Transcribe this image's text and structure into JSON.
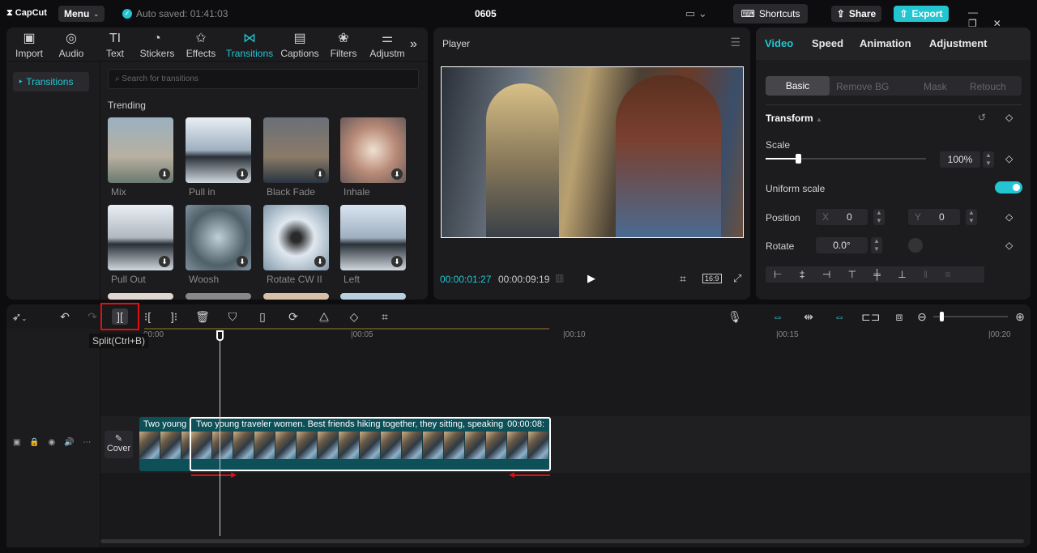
{
  "app": {
    "logo": "CapCut",
    "menu": "Menu",
    "autosave": "Auto saved: 01:41:03",
    "project": "0605",
    "shortcuts": "Shortcuts",
    "share": "Share",
    "export": "Export",
    "accent": "#22c5d0"
  },
  "toolbar": [
    {
      "label": "Import",
      "icon": "import-icon"
    },
    {
      "label": "Audio",
      "icon": "audio-icon"
    },
    {
      "label": "Text",
      "icon": "text-icon"
    },
    {
      "label": "Stickers",
      "icon": "stickers-icon"
    },
    {
      "label": "Effects",
      "icon": "effects-icon"
    },
    {
      "label": "Transitions",
      "icon": "transitions-icon"
    },
    {
      "label": "Captions",
      "icon": "captions-icon"
    },
    {
      "label": "Filters",
      "icon": "filters-icon"
    },
    {
      "label": "Adjustm",
      "icon": "adjustment-icon"
    }
  ],
  "sidebar": {
    "item": "Transitions"
  },
  "search": {
    "placeholder": "Search for transitions"
  },
  "section": "Trending",
  "transitions": [
    "Mix",
    "Pull in",
    "Black Fade",
    "Inhale",
    "Pull Out",
    "Woosh",
    "Rotate CW II",
    "Left"
  ],
  "player": {
    "title": "Player",
    "current": "00:00:01:27",
    "total": "00:00:09:19",
    "ratio": "16:9"
  },
  "inspector": {
    "tabs": [
      "Video",
      "Speed",
      "Animation",
      "Adjustment"
    ],
    "subtabs": [
      "Basic",
      "Remove BG",
      "Mask",
      "Retouch"
    ],
    "transform": "Transform",
    "scale_label": "Scale",
    "scale": "100%",
    "scale_fraction": 0.2,
    "uniform": "Uniform scale",
    "uniform_on": true,
    "position_label": "Position",
    "x_label": "X",
    "x": "0",
    "y_label": "Y",
    "y": "0",
    "rotate_label": "Rotate",
    "rotate": "0.0°"
  },
  "timeline": {
    "tooltip": "Split(Ctrl+B)",
    "ticks": [
      "00:00",
      "|00:05",
      "|00:10",
      "|00:15",
      "|00:20"
    ],
    "cover": "Cover",
    "clip_short": "Two young",
    "clip_title": "Two young traveler women. Best friends hiking together, they sitting, speaking",
    "clip_duration": "00:00:08:"
  }
}
